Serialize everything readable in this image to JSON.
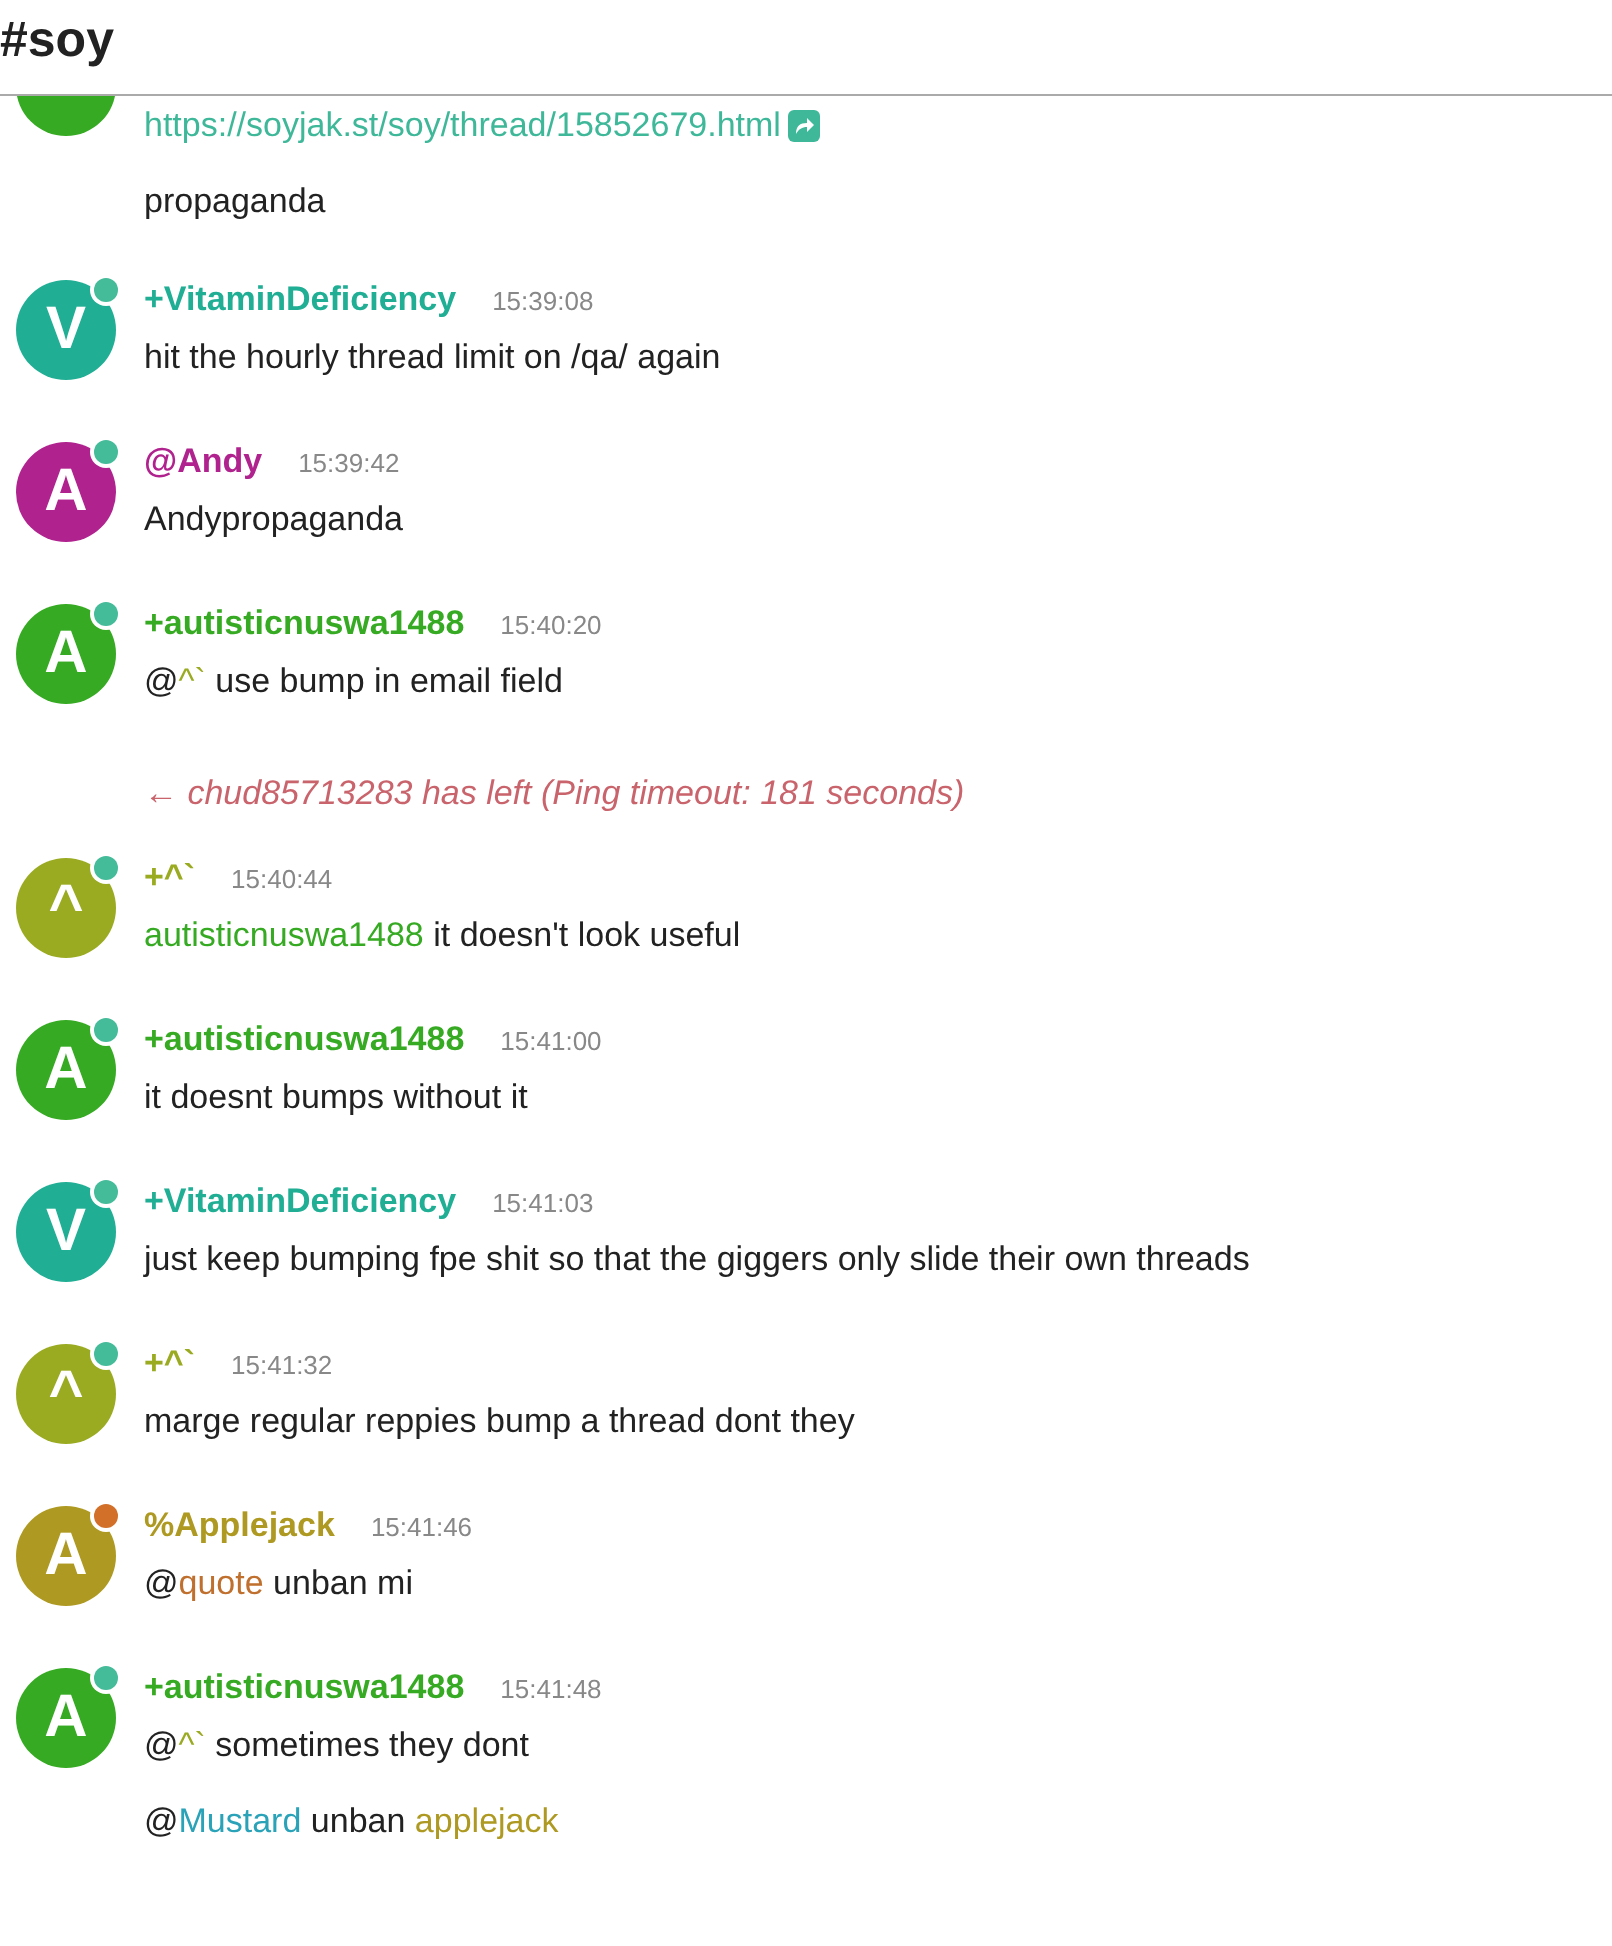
{
  "channel": {
    "title": "#soy"
  },
  "messages": [
    {
      "kind": "message",
      "clipped": true,
      "color": "#36aa22",
      "lines": [
        [
          {
            "kind": "link",
            "text": "https://soyjak.st/soy/thread/15852679.html",
            "color": "#3fb89a"
          }
        ],
        [
          {
            "kind": "text",
            "text": "propaganda"
          }
        ]
      ]
    },
    {
      "kind": "message",
      "nick": "+VitaminDeficiency",
      "time": "15:39:08",
      "color": "#20ae94",
      "avatar": "V",
      "status": {
        "color": "#44bb99"
      },
      "lines": [
        [
          {
            "kind": "text",
            "text": "hit the hourly thread limit on /qa/ again"
          }
        ]
      ]
    },
    {
      "kind": "message",
      "nick": "@Andy",
      "time": "15:39:42",
      "color": "#b0228e",
      "avatar": "A",
      "status": {
        "color": "#44bb99"
      },
      "lines": [
        [
          {
            "kind": "text",
            "text": "Andypropaganda"
          }
        ]
      ]
    },
    {
      "kind": "message",
      "nick": "+autisticnuswa1488",
      "time": "15:40:20",
      "color": "#36aa22",
      "avatar": "A",
      "status": {
        "color": "#44bb99"
      },
      "lines": [
        [
          {
            "kind": "text",
            "text": "@"
          },
          {
            "kind": "mention",
            "text": "^`",
            "color": "#9aab22"
          },
          {
            "kind": "text",
            "text": " use bump in email field"
          }
        ]
      ]
    },
    {
      "kind": "part",
      "text": "← chud85713283 has left (Ping timeout: 181 seconds)"
    },
    {
      "kind": "message",
      "nick": "+^`",
      "time": "15:40:44",
      "color": "#9aab22",
      "avatar": "^",
      "status": {
        "color": "#44bb99"
      },
      "lines": [
        [
          {
            "kind": "mention",
            "text": "autisticnuswa1488",
            "color": "#36aa22"
          },
          {
            "kind": "text",
            "text": " it doesn't look useful"
          }
        ]
      ]
    },
    {
      "kind": "message",
      "nick": "+autisticnuswa1488",
      "time": "15:41:00",
      "color": "#36aa22",
      "avatar": "A",
      "status": {
        "color": "#44bb99"
      },
      "lines": [
        [
          {
            "kind": "text",
            "text": "it doesnt bumps without it"
          }
        ]
      ]
    },
    {
      "kind": "message",
      "nick": "+VitaminDeficiency",
      "time": "15:41:03",
      "color": "#20ae94",
      "avatar": "V",
      "status": {
        "color": "#44bb99"
      },
      "lines": [
        [
          {
            "kind": "text",
            "text": "just keep bumping fpe shit so that the giggers only slide their own threads"
          }
        ]
      ]
    },
    {
      "kind": "message",
      "nick": "+^`",
      "time": "15:41:32",
      "color": "#9aab22",
      "avatar": "^",
      "status": {
        "color": "#44bb99"
      },
      "lines": [
        [
          {
            "kind": "text",
            "text": "marge regular reppies bump a thread dont they"
          }
        ]
      ]
    },
    {
      "kind": "message",
      "nick": "%Applejack",
      "time": "15:41:46",
      "color": "#ae9a22",
      "avatar": "A",
      "status": {
        "color": "#d2702a"
      },
      "lines": [
        [
          {
            "kind": "text",
            "text": "@"
          },
          {
            "kind": "mention",
            "text": "quote",
            "color": "#c0702e"
          },
          {
            "kind": "text",
            "text": " unban mi"
          }
        ]
      ]
    },
    {
      "kind": "message",
      "nick": "+autisticnuswa1488",
      "time": "15:41:48",
      "color": "#36aa22",
      "avatar": "A",
      "status": {
        "color": "#44bb99"
      },
      "lines": [
        [
          {
            "kind": "text",
            "text": "@"
          },
          {
            "kind": "mention",
            "text": "^`",
            "color": "#9aab22"
          },
          {
            "kind": "text",
            "text": " sometimes they dont"
          }
        ],
        [
          {
            "kind": "text",
            "text": "@"
          },
          {
            "kind": "mention",
            "text": "Mustard",
            "color": "#2aa2b8"
          },
          {
            "kind": "text",
            "text": " unban "
          },
          {
            "kind": "mention",
            "text": "applejack",
            "color": "#ae9a22"
          }
        ]
      ]
    }
  ]
}
